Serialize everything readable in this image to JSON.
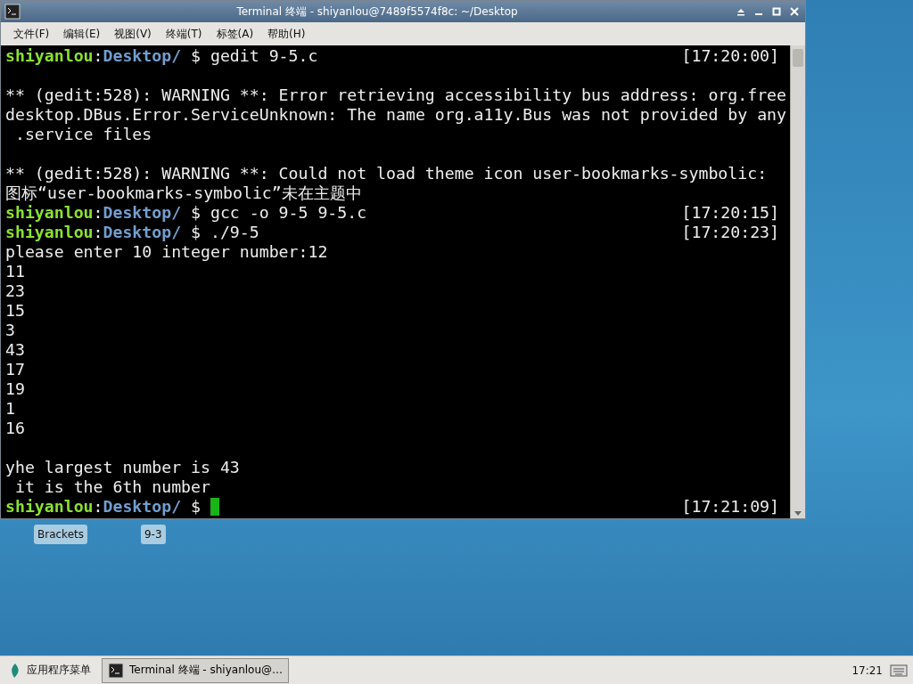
{
  "window": {
    "title": "Terminal 终端 - shiyanlou@7489f5574f8c: ~/Desktop"
  },
  "menu": [
    "文件(F)",
    "编辑(E)",
    "视图(V)",
    "终端(T)",
    "标签(A)",
    "帮助(H)"
  ],
  "terminal": {
    "lines": [
      {
        "kind": "prompt",
        "user": "shiyanlou",
        "sep": ":",
        "path": "Desktop/",
        "command": " $ gedit 9-5.c",
        "time": "[17:20:00]",
        "cursor": false
      },
      {
        "kind": "blank"
      },
      {
        "kind": "output",
        "text": "** (gedit:528): WARNING **: Error retrieving accessibility bus address: org.free"
      },
      {
        "kind": "output",
        "text": "desktop.DBus.Error.ServiceUnknown: The name org.a11y.Bus was not provided by any"
      },
      {
        "kind": "output",
        "text": " .service files"
      },
      {
        "kind": "blank"
      },
      {
        "kind": "output",
        "text": "** (gedit:528): WARNING **: Could not load theme icon user-bookmarks-symbolic:"
      },
      {
        "kind": "output",
        "text": "图标“user-bookmarks-symbolic”未在主题中"
      },
      {
        "kind": "prompt",
        "user": "shiyanlou",
        "sep": ":",
        "path": "Desktop/",
        "command": " $ gcc -o 9-5 9-5.c",
        "time": "[17:20:15]",
        "cursor": false
      },
      {
        "kind": "prompt",
        "user": "shiyanlou",
        "sep": ":",
        "path": "Desktop/",
        "command": " $ ./9-5",
        "time": "[17:20:23]",
        "cursor": false
      },
      {
        "kind": "output",
        "text": "please enter 10 integer number:12"
      },
      {
        "kind": "output",
        "text": "11"
      },
      {
        "kind": "output",
        "text": "23"
      },
      {
        "kind": "output",
        "text": "15"
      },
      {
        "kind": "output",
        "text": "3"
      },
      {
        "kind": "output",
        "text": "43"
      },
      {
        "kind": "output",
        "text": "17"
      },
      {
        "kind": "output",
        "text": "19"
      },
      {
        "kind": "output",
        "text": "1"
      },
      {
        "kind": "output",
        "text": "16"
      },
      {
        "kind": "blank"
      },
      {
        "kind": "output",
        "text": "yhe largest number is 43"
      },
      {
        "kind": "output",
        "text": " it is the 6th number"
      },
      {
        "kind": "prompt",
        "user": "shiyanlou",
        "sep": ":",
        "path": "Desktop/",
        "command": " $ ",
        "time": "[17:21:09]",
        "cursor": true
      }
    ]
  },
  "desktop_icons": [
    "Brackets",
    "9-3"
  ],
  "taskbar": {
    "start": "应用程序菜单",
    "tasks": [
      {
        "label": "Terminal 终端 - shiyanlou@…",
        "selected": true
      }
    ],
    "clock": "17:21"
  }
}
